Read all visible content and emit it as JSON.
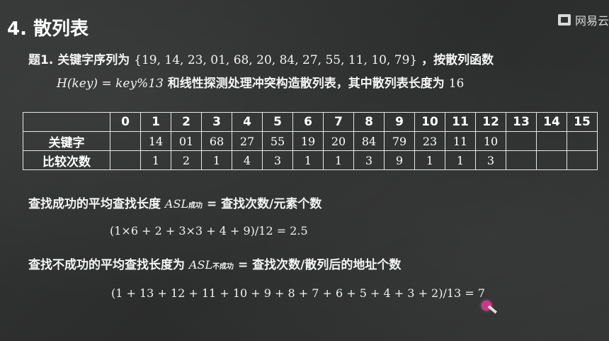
{
  "logo": {
    "text": "网易云"
  },
  "title": "4. 散列表",
  "question": {
    "prefix": "题1. 关键字序列为",
    "keys": "{19, 14, 23, 01, 68, 20, 84, 27, 55, 11, 10, 79}",
    "suffix": "，按散列函数",
    "hash_func": "H(key) = key%13",
    "line2_text": "和线性探测处理冲突构造散列表，其中散列表长度为",
    "table_len": "16"
  },
  "table": {
    "row_labels": [
      "",
      "关键字",
      "比较次数"
    ],
    "indices": [
      "0",
      "1",
      "2",
      "3",
      "4",
      "5",
      "6",
      "7",
      "8",
      "9",
      "10",
      "11",
      "12",
      "13",
      "14",
      "15"
    ],
    "keys": [
      "",
      "14",
      "01",
      "68",
      "27",
      "55",
      "19",
      "20",
      "84",
      "79",
      "23",
      "11",
      "10",
      "",
      "",
      ""
    ],
    "compares": [
      "",
      "1",
      "2",
      "1",
      "4",
      "3",
      "1",
      "1",
      "3",
      "9",
      "1",
      "1",
      "3",
      "",
      "",
      ""
    ]
  },
  "success": {
    "label": "查找成功的平均查找长度",
    "asl": "ASL",
    "asl_sub": "成功",
    "eq_text": "= 查找次数/元素个数",
    "formula": "(1×6 + 2 + 3×3 + 4 + 9)/12 = 2.5"
  },
  "fail": {
    "label": "查找不成功的平均查找长度为",
    "asl": "ASL",
    "asl_sub": "不成功",
    "eq_text": "= 查找次数/散列后的地址个数",
    "formula": "(1 + 13 + 12 + 11 + 10 + 9 + 8 + 7 + 6 + 5 + 4 + 3 + 2)/13 = 7"
  },
  "colors": {
    "board": "#2f3030",
    "chalk": "#f4f4f4",
    "pointer": "#c93a86"
  }
}
